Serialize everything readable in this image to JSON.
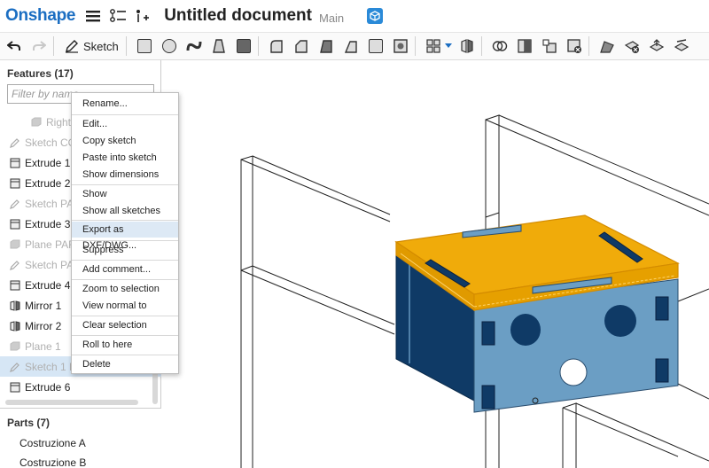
{
  "header": {
    "brand": "Onshape",
    "title": "Untitled document",
    "workspace": "Main"
  },
  "toolbar": {
    "sketch_label": "Sketch"
  },
  "features": {
    "header": "Features (17)",
    "filter_placeholder": "Filter by name",
    "items": [
      {
        "label": "Right",
        "icon": "plane-icon",
        "state": "dim"
      },
      {
        "label": "Sketch CO",
        "icon": "pencil-icon",
        "state": "dim"
      },
      {
        "label": "Extrude 1",
        "icon": "extrude-icon",
        "state": "normal"
      },
      {
        "label": "Extrude 2",
        "icon": "extrude-icon",
        "state": "normal"
      },
      {
        "label": "Sketch PA",
        "icon": "pencil-icon",
        "state": "dim"
      },
      {
        "label": "Extrude 3",
        "icon": "extrude-icon",
        "state": "normal"
      },
      {
        "label": "Plane PAF",
        "icon": "plane-icon",
        "state": "dim"
      },
      {
        "label": "Sketch PA",
        "icon": "pencil-icon",
        "state": "dim"
      },
      {
        "label": "Extrude 4",
        "icon": "extrude-icon",
        "state": "normal"
      },
      {
        "label": "Mirror 1",
        "icon": "mirror-icon",
        "state": "normal"
      },
      {
        "label": "Mirror 2",
        "icon": "mirror-icon",
        "state": "normal"
      },
      {
        "label": "Plane 1",
        "icon": "plane-icon",
        "state": "dim"
      },
      {
        "label": "Sketch 1 F",
        "icon": "pencil-icon",
        "state": "selected"
      },
      {
        "label": "Extrude 6",
        "icon": "extrude-icon",
        "state": "normal"
      }
    ]
  },
  "parts": {
    "header": "Parts (7)",
    "items": [
      "Costruzione A",
      "Costruzione B"
    ]
  },
  "context_menu": {
    "items": [
      "Rename...",
      "Edit...",
      "Copy sketch",
      "Paste into sketch",
      "Show dimensions",
      "Show",
      "Show all sketches",
      "Export as DXF/DWG...",
      "Suppress",
      "Add comment...",
      "Zoom to selection",
      "View normal to",
      "Clear selection",
      "Roll to here",
      "Delete"
    ],
    "highlighted": "Export as DXF/DWG..."
  },
  "colors": {
    "brand": "#1b6ec2",
    "selection_orange": "#f0ab0a",
    "part_blue": "#6b9ec4",
    "part_dark": "#0f3a66"
  }
}
